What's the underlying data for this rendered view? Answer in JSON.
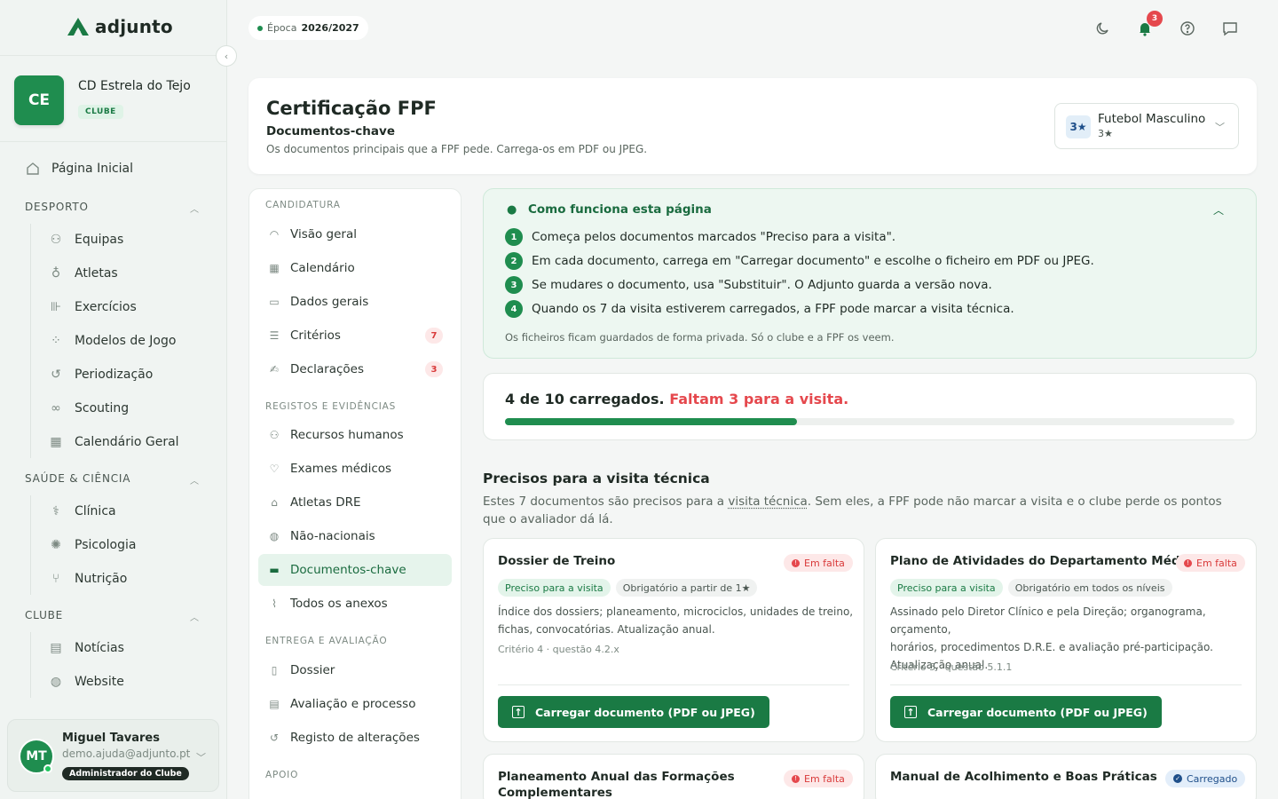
{
  "app": {
    "brand": "adjunto"
  },
  "club": {
    "initials": "CE",
    "name": "CD Estrela do Tejo",
    "badge": "CLUBE"
  },
  "sidebar": {
    "home": "Página Inicial",
    "sections": [
      {
        "title": "DESPORTO",
        "items": [
          "Equipas",
          "Atletas",
          "Exercícios",
          "Modelos de Jogo",
          "Periodização",
          "Scouting",
          "Calendário Geral"
        ]
      },
      {
        "title": "SAÚDE & CIÊNCIA",
        "items": [
          "Clínica",
          "Psicologia",
          "Nutrição"
        ]
      },
      {
        "title": "CLUBE",
        "items": [
          "Notícias",
          "Website"
        ]
      }
    ]
  },
  "user": {
    "initials": "MT",
    "name": "Miguel Tavares",
    "email": "demo.ajuda@adjunto.pt",
    "role": "Administrador do Clube"
  },
  "topbar": {
    "season_label": "Época",
    "season_value": "2026/2027",
    "notifications": "3"
  },
  "header": {
    "title": "Certificação FPF",
    "subtitle": "Documentos-chave",
    "description": "Os documentos principais que a FPF pede. Carrega-os em PDF ou JPEG.",
    "team_badge": "3★",
    "team_name": "Futebol Masculino",
    "team_stars": "3★"
  },
  "subnav": {
    "sections": [
      "CANDIDATURA",
      "REGISTOS E EVIDÊNCIAS",
      "ENTREGA E AVALIAÇÃO",
      "APOIO"
    ],
    "candidatura": [
      {
        "label": "Visão geral"
      },
      {
        "label": "Calendário"
      },
      {
        "label": "Dados gerais"
      },
      {
        "label": "Critérios",
        "count": "7"
      },
      {
        "label": "Declarações",
        "count": "3"
      }
    ],
    "registos": [
      "Recursos humanos",
      "Exames médicos",
      "Atletas DRE",
      "Não-nacionais",
      "Documentos-chave",
      "Todos os anexos"
    ],
    "entrega": [
      "Dossier",
      "Avaliação e processo",
      "Registo de alterações"
    ]
  },
  "howto": {
    "title": "Como funciona esta página",
    "steps": [
      "Começa pelos documentos marcados \"Preciso para a visita\".",
      "Em cada documento, carrega em \"Carregar documento\" e escolhe o ficheiro em PDF ou JPEG.",
      "Se mudares o documento, usa \"Substituir\". O Adjunto guarda a versão nova.",
      "Quando os 7 da visita estiverem carregados, a FPF pode marcar a visita técnica."
    ],
    "note": "Os ficheiros ficam guardados de forma privada. Só o clube e a FPF os veem."
  },
  "progress": {
    "text": "4 de 10 carregados.",
    "missing": "Faltam 3 para a visita.",
    "fraction": 0.4
  },
  "section": {
    "title": "Precisos para a visita técnica",
    "desc_before": "Estes 7 documentos são precisos para a ",
    "desc_link": "visita técnica",
    "desc_after": ". Sem eles, a FPF pode não marcar a visita e o clube perde os pontos que o avaliador dá lá."
  },
  "docs": [
    {
      "title": "Dossier de Treino",
      "status": "Em falta",
      "chip1": "Preciso para a visita",
      "chip2": "Obrigatório a partir de 1★",
      "desc1": "Índice dos dossiers; planeamento, microciclos, unidades de treino,",
      "desc2": "fichas, convocatórias. Atualização anual.",
      "criterion": "Critério 4 · questão 4.2.x",
      "button": "Carregar documento (PDF ou JPEG)"
    },
    {
      "title": "Plano de Atividades do Departamento Médico",
      "status": "Em falta",
      "chip1": "Preciso para a visita",
      "chip2": "Obrigatório em todos os níveis",
      "desc1": "Assinado pelo Diretor Clínico e pela Direção; organograma, orçamento,",
      "desc2": "horários, procedimentos D.R.E. e avaliação pré-participação.",
      "desc3": "Atualização anual.",
      "criterion": "Critério 5 · questão 5.1.1",
      "button": "Carregar documento (PDF ou JPEG)"
    },
    {
      "title1": "Planeamento Anual das Formações",
      "title2": "Complementares",
      "status": "Em falta"
    },
    {
      "title": "Manual de Acolhimento e Boas Práticas",
      "status": "Carregado"
    }
  ]
}
